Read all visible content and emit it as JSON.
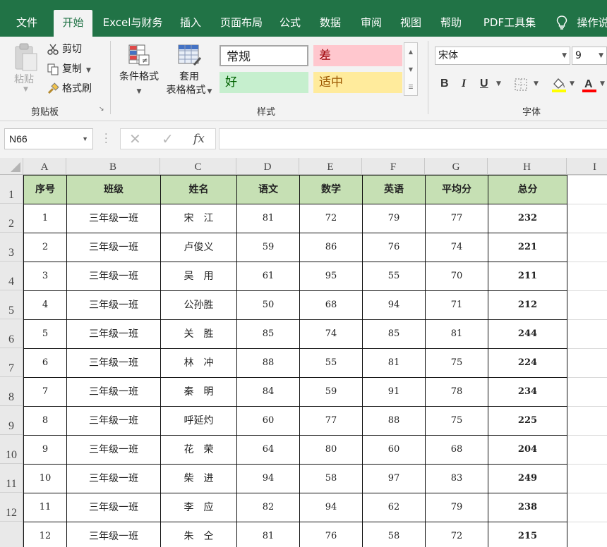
{
  "tabs": [
    "文件",
    "开始",
    "Excel与财务",
    "插入",
    "页面布局",
    "公式",
    "数据",
    "审阅",
    "视图",
    "帮助",
    "PDF工具集",
    "操作说"
  ],
  "active_tab": "开始",
  "clipboard": {
    "paste": "粘贴",
    "cut": "剪切",
    "copy": "复制",
    "format_painter": "格式刷",
    "group_label": "剪贴板"
  },
  "styles": {
    "conditional_format": "条件格式",
    "table_format_line1": "套用",
    "table_format_line2": "表格格式",
    "normal": "常规",
    "bad": "差",
    "good": "好",
    "neutral": "适中",
    "group_label": "样式"
  },
  "font": {
    "name": "宋体",
    "size": "9",
    "bold": "B",
    "italic": "I",
    "underline": "U",
    "group_label": "字体"
  },
  "formula_bar": {
    "name_box": "N66",
    "fx": "fx",
    "cancel": "✕",
    "confirm": "✓",
    "value": ""
  },
  "colors": {
    "ribbon_green": "#217346",
    "header_fill": "#c6e0b4",
    "bad_fill": "#ffc7ce",
    "bad_text": "#9c0006",
    "good_fill": "#c6efce",
    "good_text": "#006100",
    "neutral_fill": "#ffeb9c",
    "neutral_text": "#9c5700"
  },
  "sheet": {
    "columns": [
      "A",
      "B",
      "C",
      "D",
      "E",
      "F",
      "G",
      "H",
      "I"
    ],
    "header": [
      "序号",
      "班级",
      "姓名",
      "语文",
      "数学",
      "英语",
      "平均分",
      "总分"
    ],
    "rows": [
      [
        "1",
        "三年级一班",
        "宋　江",
        "81",
        "72",
        "79",
        "77",
        "232"
      ],
      [
        "2",
        "三年级一班",
        "卢俊义",
        "59",
        "86",
        "76",
        "74",
        "221"
      ],
      [
        "3",
        "三年级一班",
        "吴　用",
        "61",
        "95",
        "55",
        "70",
        "211"
      ],
      [
        "4",
        "三年级一班",
        "公孙胜",
        "50",
        "68",
        "94",
        "71",
        "212"
      ],
      [
        "5",
        "三年级一班",
        "关　胜",
        "85",
        "74",
        "85",
        "81",
        "244"
      ],
      [
        "6",
        "三年级一班",
        "林　冲",
        "88",
        "55",
        "81",
        "75",
        "224"
      ],
      [
        "7",
        "三年级一班",
        "秦　明",
        "84",
        "59",
        "91",
        "78",
        "234"
      ],
      [
        "8",
        "三年级一班",
        "呼延灼",
        "60",
        "77",
        "88",
        "75",
        "225"
      ],
      [
        "9",
        "三年级一班",
        "花　荣",
        "64",
        "80",
        "60",
        "68",
        "204"
      ],
      [
        "10",
        "三年级一班",
        "柴　进",
        "94",
        "58",
        "97",
        "83",
        "249"
      ],
      [
        "11",
        "三年级一班",
        "李　应",
        "82",
        "94",
        "62",
        "79",
        "238"
      ],
      [
        "12",
        "三年级一班",
        "朱　仝",
        "81",
        "76",
        "58",
        "72",
        "215"
      ]
    ],
    "row_numbers": [
      "1",
      "2",
      "3",
      "4",
      "5",
      "6",
      "7",
      "8",
      "9",
      "10",
      "11",
      "12"
    ]
  }
}
